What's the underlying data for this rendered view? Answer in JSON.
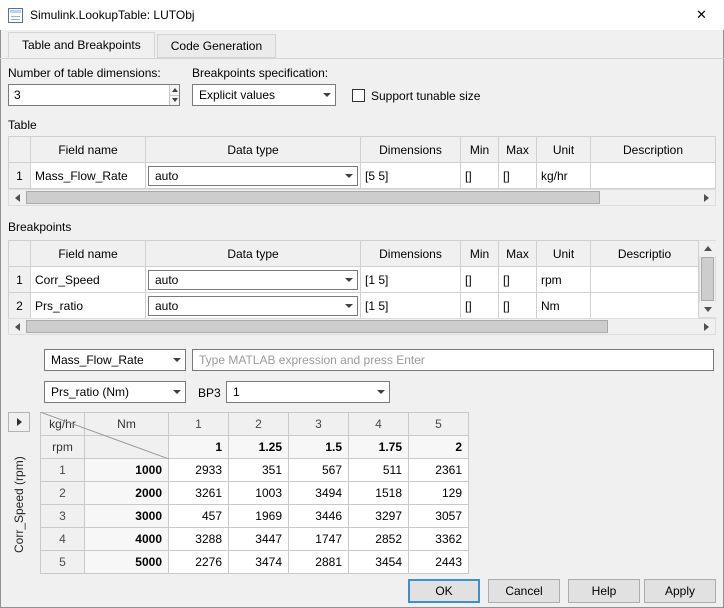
{
  "window": {
    "title": "Simulink.LookupTable: LUTObj",
    "close_glyph": "✕"
  },
  "tabs": [
    {
      "label": "Table and Breakpoints"
    },
    {
      "label": "Code Generation"
    }
  ],
  "controls": {
    "dims_label": "Number of table dimensions:",
    "dims_value": "3",
    "bp_spec_label": "Breakpoints specification:",
    "bp_spec_value": "Explicit values",
    "tunable_label": "Support tunable size"
  },
  "table_section": {
    "title": "Table",
    "headers": {
      "field": "Field name",
      "dtype": "Data type",
      "dims": "Dimensions",
      "min": "Min",
      "max": "Max",
      "unit": "Unit",
      "desc": "Description"
    },
    "rows": [
      {
        "num": "1",
        "field": "Mass_Flow_Rate",
        "dtype": "auto",
        "dims": "[5 5]",
        "min": "[]",
        "max": "[]",
        "unit": "kg/hr",
        "desc": ""
      }
    ]
  },
  "bp_section": {
    "title": "Breakpoints",
    "headers": {
      "field": "Field name",
      "dtype": "Data type",
      "dims": "Dimensions",
      "min": "Min",
      "max": "Max",
      "unit": "Unit",
      "desc": "Descriptio"
    },
    "rows": [
      {
        "num": "1",
        "field": "Corr_Speed",
        "dtype": "auto",
        "dims": "[1 5]",
        "min": "[]",
        "max": "[]",
        "unit": "rpm",
        "desc": ""
      },
      {
        "num": "2",
        "field": "Prs_ratio",
        "dtype": "auto",
        "dims": "[1 5]",
        "min": "[]",
        "max": "[]",
        "unit": "Nm",
        "desc": ""
      }
    ]
  },
  "editor": {
    "field_select": "Mass_Flow_Rate",
    "expression_placeholder": "Type MATLAB expression and press Enter",
    "bp_select": "Prs_ratio (Nm)",
    "bp3_label": "BP3",
    "bp3_value": "1"
  },
  "grid": {
    "vertical_axis_label": "Corr_Speed (rpm)",
    "table_unit": "kg/hr",
    "col_axis_unit": "Nm",
    "row_axis_unit": "rpm",
    "col_index": [
      "1",
      "2",
      "3",
      "4",
      "5"
    ],
    "col_bp": [
      "1",
      "1.25",
      "1.5",
      "1.75",
      "2"
    ],
    "row_index": [
      "1",
      "2",
      "3",
      "4",
      "5"
    ],
    "row_bp": [
      "1000",
      "2000",
      "3000",
      "4000",
      "5000"
    ],
    "values": [
      [
        "2933",
        "351",
        "567",
        "511",
        "2361"
      ],
      [
        "3261",
        "1003",
        "3494",
        "1518",
        "129"
      ],
      [
        "457",
        "1969",
        "3446",
        "3297",
        "3057"
      ],
      [
        "3288",
        "3447",
        "1747",
        "2852",
        "3362"
      ],
      [
        "2276",
        "3474",
        "2881",
        "3454",
        "2443"
      ]
    ]
  },
  "buttons": {
    "ok": "OK",
    "cancel": "Cancel",
    "help": "Help",
    "apply": "Apply"
  }
}
